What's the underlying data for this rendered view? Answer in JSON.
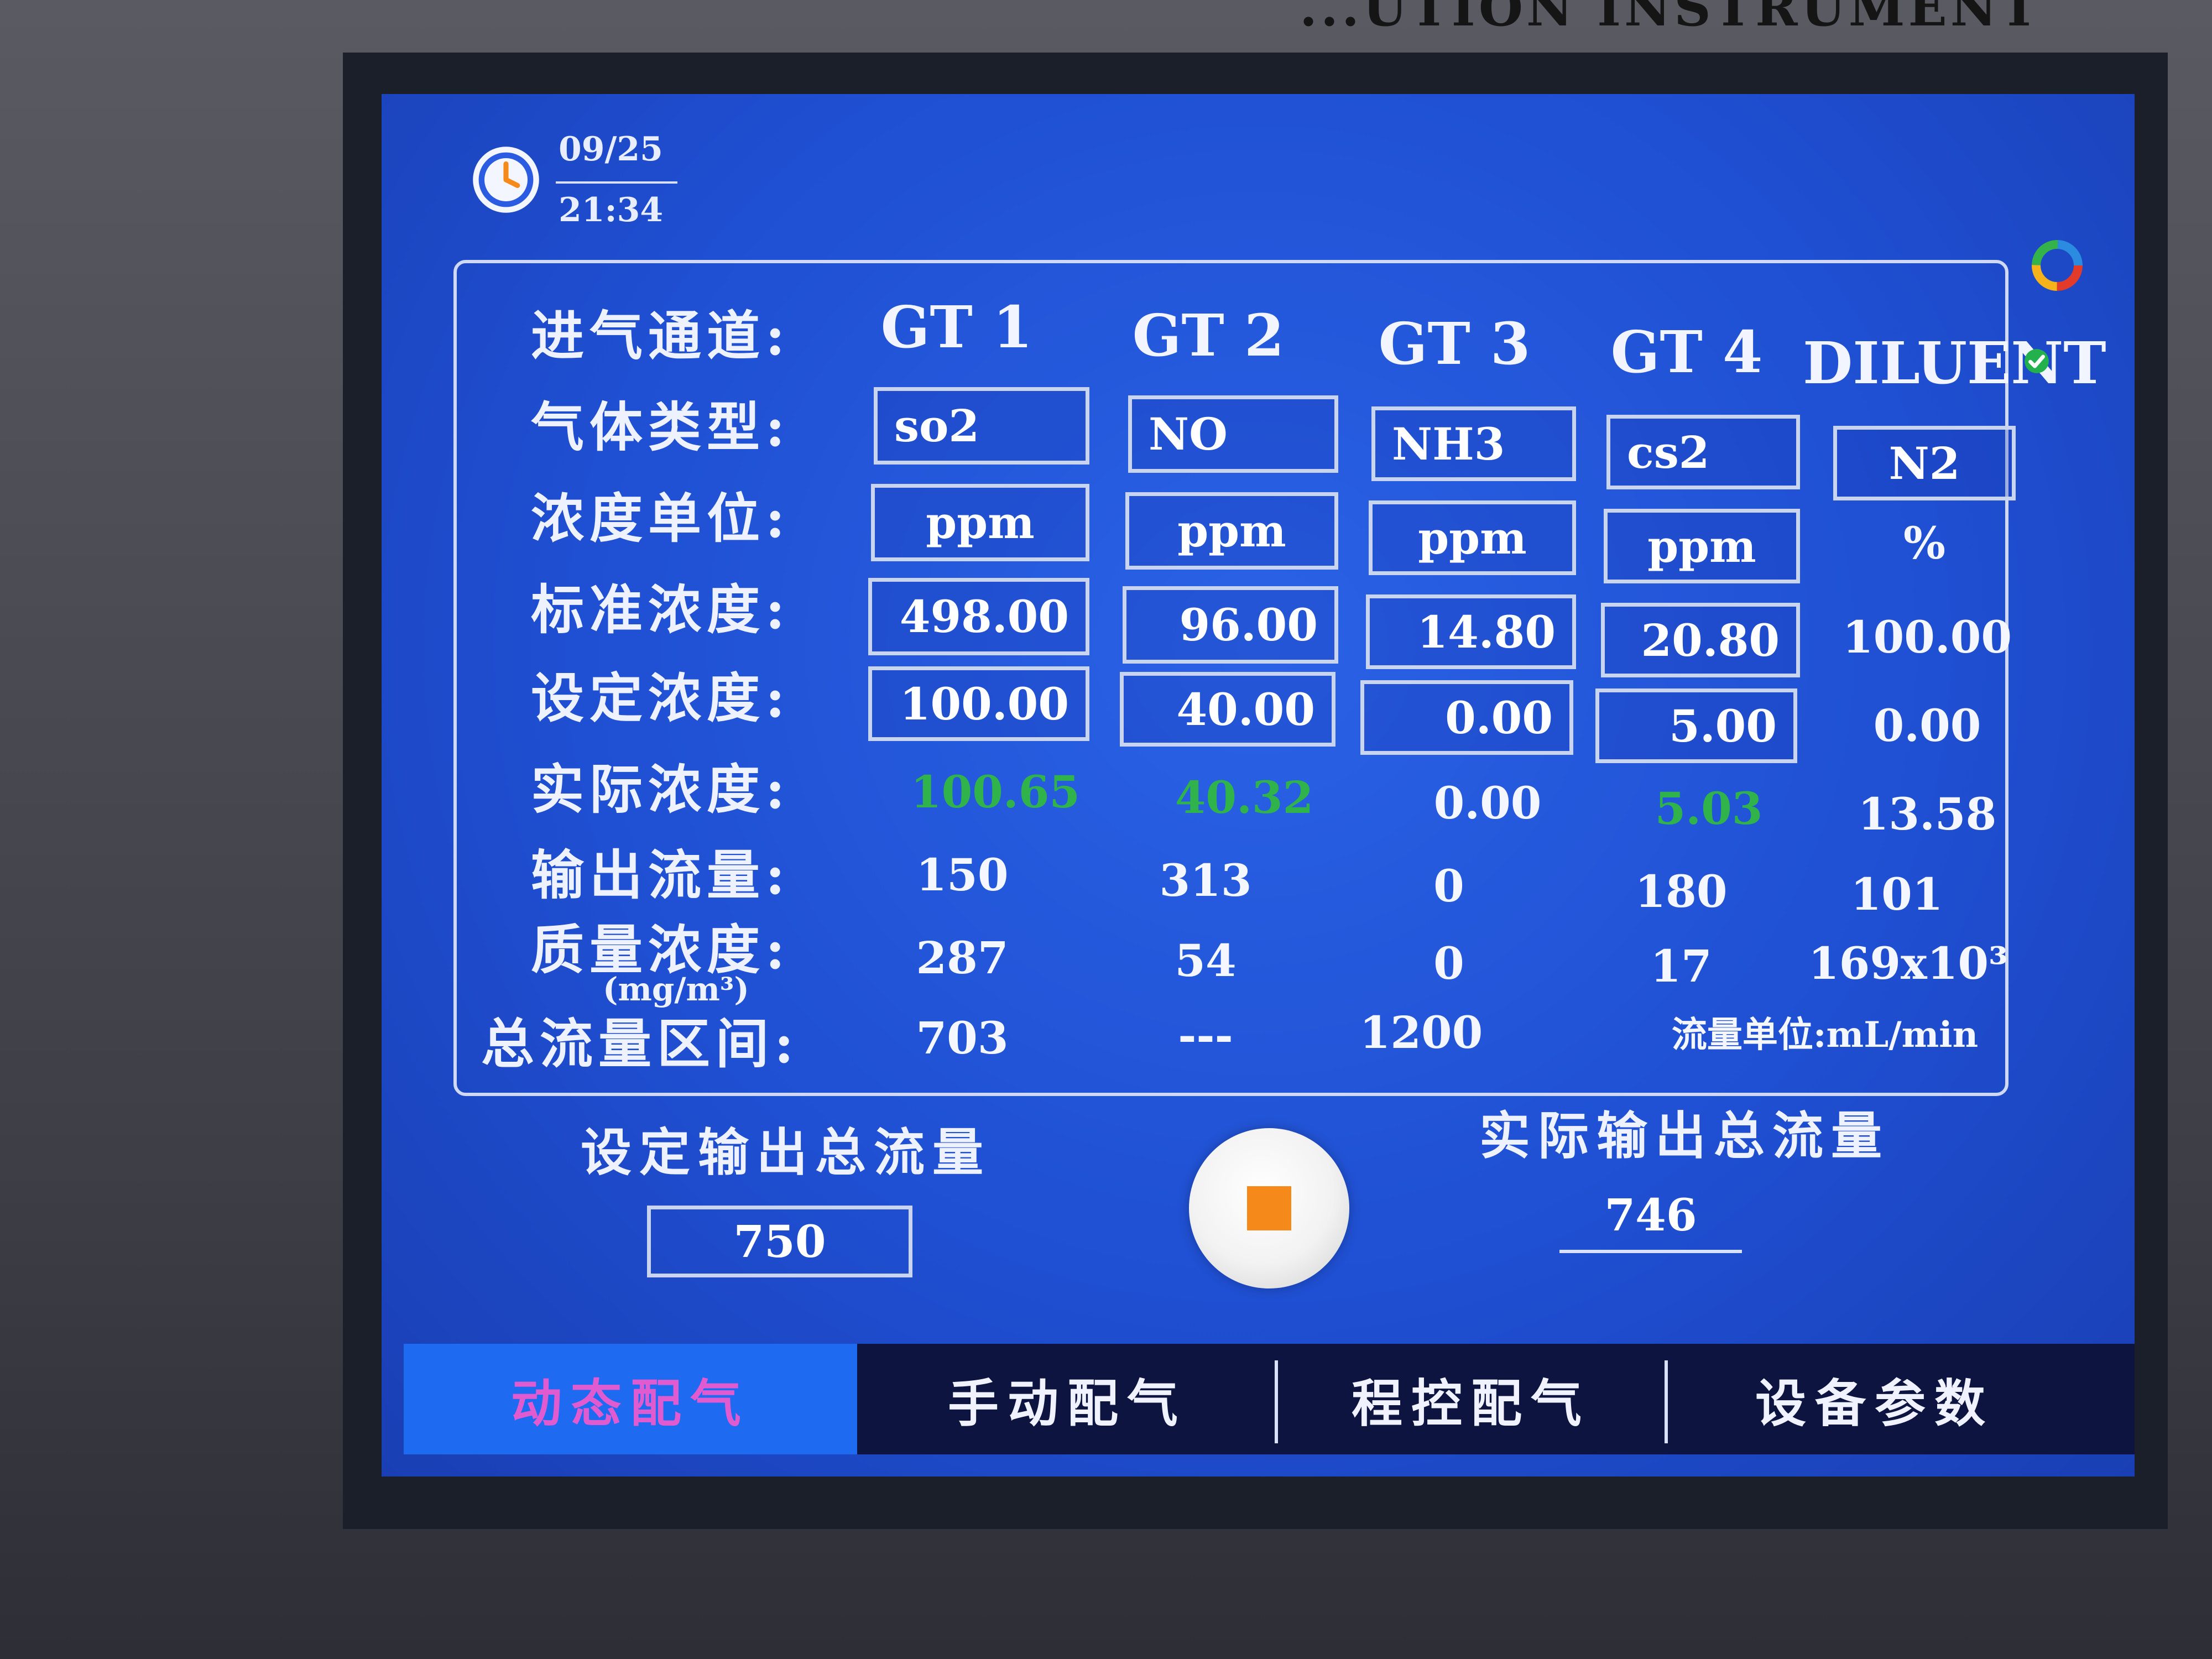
{
  "brand_text": "...UTION INSTRUMENT",
  "header": {
    "date": "09/25",
    "time": "21:34"
  },
  "icons": {
    "clock": "clock-icon",
    "logo": "ring-logo-icon",
    "check": "check-icon",
    "stop": "stop-icon"
  },
  "colors": {
    "screen_blue": "#1f4fd2",
    "actual_ok_green": "#2fb34a",
    "active_tab_bg": "#1e6af0",
    "active_tab_text": "#e05ad0",
    "stop_square": "#f5891a"
  },
  "rows": {
    "channel": "进气通道:",
    "gas_type": "气体类型:",
    "conc_unit": "浓度单位:",
    "std_conc": "标准浓度:",
    "set_conc": "设定浓度:",
    "actual_conc": "实际浓度:",
    "output_flow": "输出流量:",
    "mass_conc": "质量浓度:",
    "mass_conc_unit": "(mg/m³)",
    "total_flow_range": "总流量区间:"
  },
  "channels": [
    {
      "name": "GT 1",
      "gas": "so2",
      "unit": "ppm",
      "standard": "498.00",
      "setpoint": "100.00",
      "actual": "100.65",
      "actual_ok": true,
      "output_flow": "150",
      "mass_conc": "287",
      "range": "703"
    },
    {
      "name": "GT 2",
      "gas": "NO",
      "unit": "ppm",
      "standard": "96.00",
      "setpoint": "40.00",
      "actual": "40.32",
      "actual_ok": true,
      "output_flow": "313",
      "mass_conc": "54",
      "range": "---"
    },
    {
      "name": "GT 3",
      "gas": "NH3",
      "unit": "ppm",
      "standard": "14.80",
      "setpoint": "0.00",
      "actual": "0.00",
      "actual_ok": false,
      "output_flow": "0",
      "mass_conc": "0",
      "range": "1200"
    },
    {
      "name": "GT 4",
      "gas": "cs2",
      "unit": "ppm",
      "standard": "20.80",
      "setpoint": "5.00",
      "actual": "5.03",
      "actual_ok": true,
      "output_flow": "180",
      "mass_conc": "17"
    },
    {
      "name": "DILUENT",
      "gas": "N2",
      "unit": "%",
      "standard": "100.00",
      "setpoint": "0.00",
      "actual": "13.58",
      "actual_ok": false,
      "output_flow": "101",
      "mass_conc": "169x10³"
    }
  ],
  "flow_unit_note": "流量单位:mL/min",
  "set_total_label": "设定输出总流量",
  "set_total_value": "750",
  "actual_total_label": "实际输出总流量",
  "actual_total_value": "746",
  "tabs": [
    {
      "label": "动态配气",
      "active": true
    },
    {
      "label": "手动配气",
      "active": false
    },
    {
      "label": "程控配气",
      "active": false
    },
    {
      "label": "设备参数",
      "active": false
    }
  ]
}
